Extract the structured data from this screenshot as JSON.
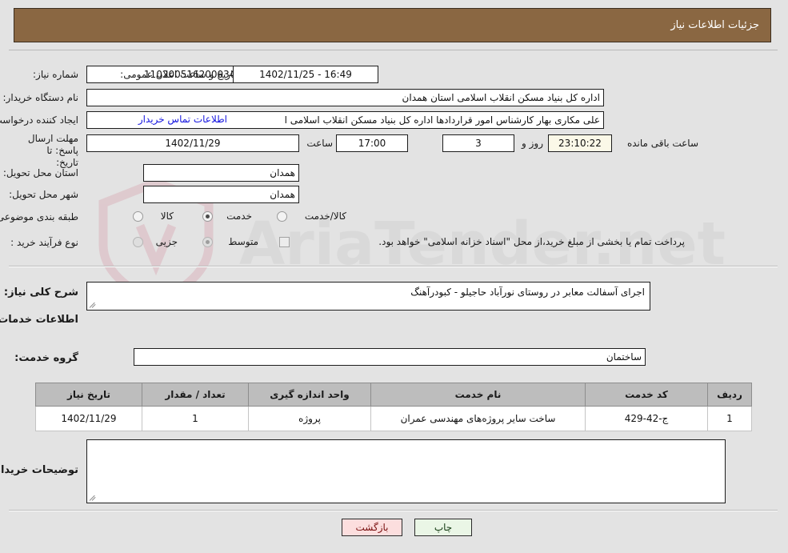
{
  "header": {
    "title": "جزئیات اطلاعات نیاز"
  },
  "form": {
    "need_number_label": "شماره نیاز:",
    "need_number_value": "1102005162000341",
    "announce_label": "تاریخ و ساعت اعلان عمومی:",
    "announce_value": "16:49 - 1402/11/25",
    "buyer_org_label": "نام دستگاه خریدار:",
    "buyer_org_value": "اداره کل بنیاد مسکن انقلاب اسلامی استان همدان",
    "creator_label": "ایجاد کننده درخواست:",
    "creator_value": "علی مکاری بهار کارشناس امور قراردادها اداره کل بنیاد مسکن انقلاب اسلامی ا",
    "contact_link": "اطلاعات تماس خریدار",
    "deadline_label": "مهلت ارسال پاسخ: تا تاریخ:",
    "deadline_date": "1402/11/29",
    "deadline_hour_label": "ساعت",
    "deadline_hour_value": "17:00",
    "remaining_days": "3",
    "remaining_days_label": "روز و",
    "remaining_time": "23:10:22",
    "remaining_time_label": "ساعت باقی مانده",
    "province_label": "استان محل تحویل:",
    "province_value": "همدان",
    "city_label": "شهر محل تحویل:",
    "city_value": "همدان",
    "category_label": "طبقه بندی موضوعی:",
    "category_options": [
      {
        "label": "کالا",
        "checked": false
      },
      {
        "label": "خدمت",
        "checked": true
      },
      {
        "label": "کالا/خدمت",
        "checked": false
      }
    ],
    "process_label": "نوع فرآیند خرید :",
    "process_options": [
      {
        "label": "جزیی",
        "checked": false
      },
      {
        "label": "متوسط",
        "checked": true
      }
    ],
    "treasury_checkbox_label": "پرداخت تمام یا بخشی از مبلغ خرید،از محل \"اسناد خزانه اسلامی\" خواهد بود.",
    "treasury_checked": false
  },
  "summary": {
    "label": "شرح کلی نیاز:",
    "value": "اجرای آسفالت معابر در روستای نورآباد حاجیلو  -  کبودرآهنگ"
  },
  "services": {
    "heading": "اطلاعات خدمات مورد نیاز",
    "group_label": "گروه خدمت:",
    "group_value": "ساختمان",
    "table": {
      "columns": [
        "ردیف",
        "کد خدمت",
        "نام خدمت",
        "واحد اندازه گیری",
        "تعداد / مقدار",
        "تاریخ نیاز"
      ],
      "rows": [
        {
          "row": "1",
          "code": "ج-42-429",
          "name": "ساخت سایر پروژه‌های مهندسی عمران",
          "unit": "پروژه",
          "qty": "1",
          "date": "1402/11/29"
        }
      ]
    }
  },
  "buyer_notes": {
    "label": "توضیحات خریدار:",
    "value": ""
  },
  "footer": {
    "print_label": "چاپ",
    "back_label": "بازگشت"
  },
  "watermark": {
    "text": "AriaTender.net"
  },
  "colors": {
    "header_bg": "#8a6742",
    "page_bg": "#e3e3e3",
    "link": "#1515e0",
    "table_header_bg": "#bdbdbd",
    "print_btn_bg": "#eaf6e6",
    "back_btn_bg": "#fcdede",
    "highlight_field_bg": "#fbf8e8"
  }
}
